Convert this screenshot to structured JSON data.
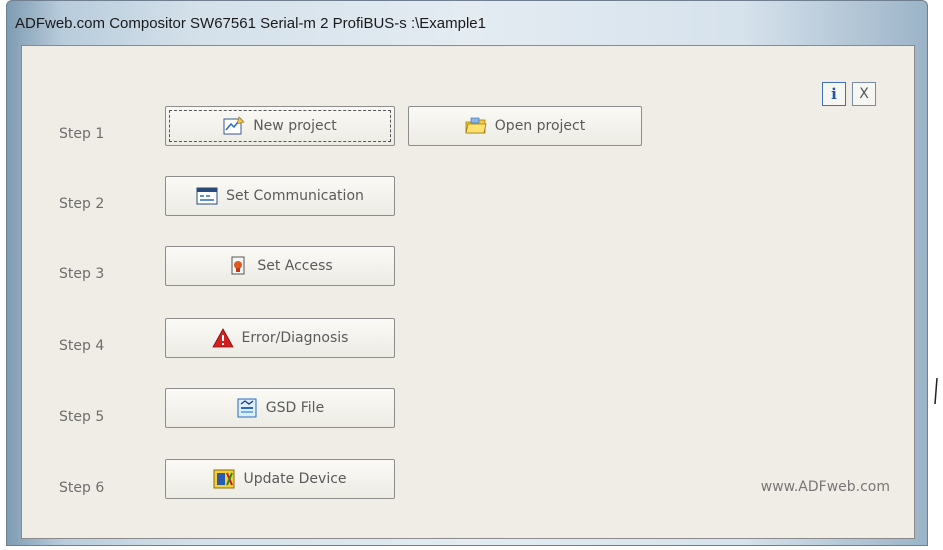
{
  "window": {
    "title": "ADFweb.com Compositor SW67561 Serial-m 2 ProfiBUS-s :\\Example1"
  },
  "toolbar": {
    "info_label": "i",
    "close_label": "X"
  },
  "steps": [
    {
      "label": "Step 1",
      "button": "New project",
      "icon": "new-project-icon"
    },
    {
      "label": "Step 2",
      "button": "Set Communication",
      "icon": "communication-icon"
    },
    {
      "label": "Step 3",
      "button": "Set Access",
      "icon": "access-icon"
    },
    {
      "label": "Step 4",
      "button": "Error/Diagnosis",
      "icon": "warning-icon"
    },
    {
      "label": "Step 5",
      "button": "GSD File",
      "icon": "gsd-file-icon"
    },
    {
      "label": "Step 6",
      "button": "Update Device",
      "icon": "update-device-icon"
    }
  ],
  "open_project": {
    "label": "Open project",
    "icon": "folder-icon"
  },
  "footer": {
    "website": "www.ADFweb.com"
  },
  "colors": {
    "client_bg": "#efede5",
    "step_text": "#6e6e6e",
    "warning": "#d22020",
    "info": "#1f55b0"
  }
}
